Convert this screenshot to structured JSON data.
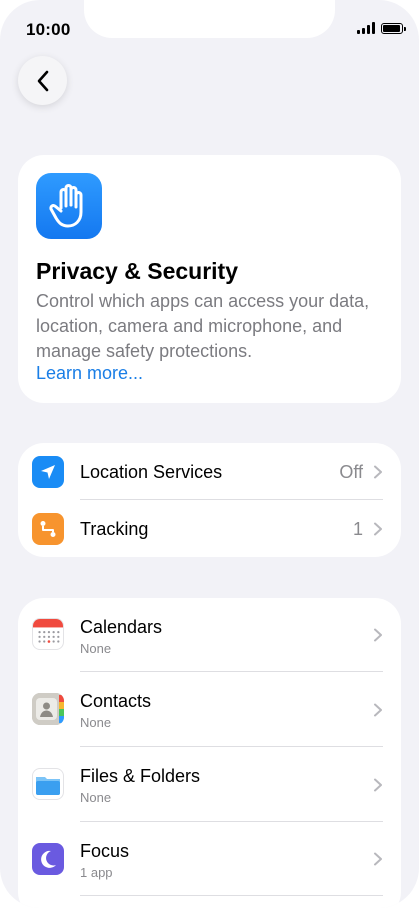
{
  "status": {
    "time": "10:00"
  },
  "colors": {
    "accent": "#1a7ee6",
    "hero_icon": "#1f86f5",
    "location_icon": "#1a8cf5",
    "tracking_icon": "#f7942e",
    "focus_icon": "#6a5ae0"
  },
  "hero": {
    "icon": "raised-hand-icon",
    "title": "Privacy & Security",
    "description": "Control which apps can access your data, location, camera and microphone, and manage safety protections.",
    "link": "Learn more..."
  },
  "group1": {
    "items": [
      {
        "icon": "location-arrow-icon",
        "label": "Location Services",
        "value": "Off"
      },
      {
        "icon": "tracking-icon",
        "label": "Tracking",
        "value": "1"
      }
    ]
  },
  "group2": {
    "items": [
      {
        "icon": "calendar-icon",
        "label": "Calendars",
        "sub": "None"
      },
      {
        "icon": "contacts-icon",
        "label": "Contacts",
        "sub": "None"
      },
      {
        "icon": "folder-icon",
        "label": "Files & Folders",
        "sub": "None"
      },
      {
        "icon": "moon-icon",
        "label": "Focus",
        "sub": "1 app"
      }
    ]
  }
}
